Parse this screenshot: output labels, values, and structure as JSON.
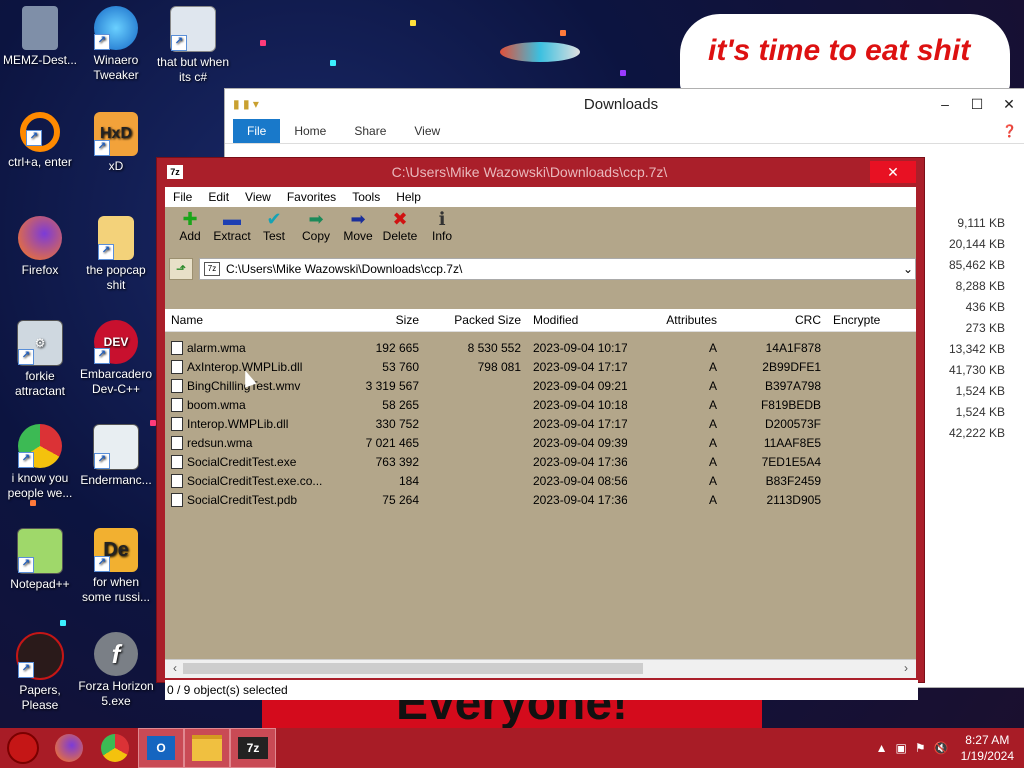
{
  "desktop": {
    "icons": [
      {
        "label": "MEMZ-Dest...",
        "icon": "trash-icon"
      },
      {
        "label": "Winaero Tweaker",
        "icon": "winaero-icon"
      },
      {
        "label": "that but when its c#",
        "icon": "stack-icon"
      },
      {
        "label": "ctrl+a, enter",
        "icon": "ring-icon"
      },
      {
        "label": "xD",
        "icon": "hxd-icon"
      },
      {
        "label": "Firefox",
        "icon": "firefox-icon"
      },
      {
        "label": "the popcap shit",
        "icon": "popcap-icon"
      },
      {
        "label": "forkie attractant",
        "icon": "gear-icon"
      },
      {
        "label": "Embarcadero Dev-C++",
        "icon": "devcpp-icon"
      },
      {
        "label": "i know you people we...",
        "icon": "chrome-icon"
      },
      {
        "label": "Endermanc...",
        "icon": "window-icon"
      },
      {
        "label": "Notepad++",
        "icon": "notepadpp-icon"
      },
      {
        "label": "for when some russi...",
        "icon": "de-icon"
      },
      {
        "label": "Papers, Please",
        "icon": "papers-icon"
      },
      {
        "label": "Forza Horizon 5.exe",
        "icon": "flash-icon"
      }
    ],
    "meme_top": "it's time to eat shit",
    "meme_bottom": "Everyone!"
  },
  "explorer": {
    "title": "Downloads",
    "tabs": [
      "File",
      "Home",
      "Share",
      "View"
    ],
    "sizes": [
      "9,111 KB",
      "20,144 KB",
      "85,462 KB",
      "8,288 KB",
      "436 KB",
      "273 KB",
      "13,342 KB",
      "41,730 KB",
      "1,524 KB",
      "1,524 KB",
      "42,222 KB"
    ]
  },
  "zip": {
    "title": "C:\\Users\\Mike Wazowski\\Downloads\\ccp.7z\\",
    "app_icon": "7z",
    "menu": [
      "File",
      "Edit",
      "View",
      "Favorites",
      "Tools",
      "Help"
    ],
    "toolbar": [
      {
        "label": "Add",
        "icon": "plus-icon",
        "glyph": "✚",
        "color": "#1aa51a"
      },
      {
        "label": "Extract",
        "icon": "minus-icon",
        "glyph": "▬",
        "color": "#1d3fb3"
      },
      {
        "label": "Test",
        "icon": "check-icon",
        "glyph": "✔",
        "color": "#16a3b5"
      },
      {
        "label": "Copy",
        "icon": "copy-arrow-icon",
        "glyph": "➡",
        "color": "#1c8a5a"
      },
      {
        "label": "Move",
        "icon": "move-arrow-icon",
        "glyph": "➡",
        "color": "#1b2f9a"
      },
      {
        "label": "Delete",
        "icon": "delete-x-icon",
        "glyph": "✖",
        "color": "#d01212"
      },
      {
        "label": "Info",
        "icon": "info-icon",
        "glyph": "ℹ",
        "color": "#333333"
      }
    ],
    "path": "C:\\Users\\Mike Wazowski\\Downloads\\ccp.7z\\",
    "columns": [
      "Name",
      "Size",
      "Packed Size",
      "Modified",
      "Attributes",
      "CRC",
      "Encrypte"
    ],
    "files": [
      {
        "name": "alarm.wma",
        "size": "192 665",
        "packed": "8 530 552",
        "modified": "2023-09-04 10:17",
        "attr": "A",
        "crc": "14A1F878"
      },
      {
        "name": "AxInterop.WMPLib.dll",
        "size": "53 760",
        "packed": "798 081",
        "modified": "2023-09-04 17:17",
        "attr": "A",
        "crc": "2B99DFE1"
      },
      {
        "name": "BingChillingTest.wmv",
        "size": "3 319 567",
        "packed": "",
        "modified": "2023-09-04 09:21",
        "attr": "A",
        "crc": "B397A798"
      },
      {
        "name": "boom.wma",
        "size": "58 265",
        "packed": "",
        "modified": "2023-09-04 10:18",
        "attr": "A",
        "crc": "F819BEDB"
      },
      {
        "name": "Interop.WMPLib.dll",
        "size": "330 752",
        "packed": "",
        "modified": "2023-09-04 17:17",
        "attr": "A",
        "crc": "D200573F"
      },
      {
        "name": "redsun.wma",
        "size": "7 021 465",
        "packed": "",
        "modified": "2023-09-04 09:39",
        "attr": "A",
        "crc": "11AAF8E5"
      },
      {
        "name": "SocialCreditTest.exe",
        "size": "763 392",
        "packed": "",
        "modified": "2023-09-04 17:36",
        "attr": "A",
        "crc": "7ED1E5A4"
      },
      {
        "name": "SocialCreditTest.exe.co...",
        "size": "184",
        "packed": "",
        "modified": "2023-09-04 08:56",
        "attr": "A",
        "crc": "B83F2459"
      },
      {
        "name": "SocialCreditTest.pdb",
        "size": "75 264",
        "packed": "",
        "modified": "2023-09-04 17:36",
        "attr": "A",
        "crc": "2113D905"
      }
    ],
    "status": "0 / 9 object(s) selected"
  },
  "taskbar": {
    "apps": [
      {
        "name": "ruby-icon",
        "color": "#c51616"
      },
      {
        "name": "firefox-icon",
        "color": "#ff7b1a"
      },
      {
        "name": "chrome-icon",
        "color": "#2b9a41"
      },
      {
        "name": "outlook-icon",
        "color": "#1565c0"
      },
      {
        "name": "file-explorer-icon",
        "color": "#f0c040"
      },
      {
        "name": "7zip-icon",
        "color": "#222222"
      }
    ],
    "time": "8:27 AM",
    "date": "1/19/2024"
  }
}
